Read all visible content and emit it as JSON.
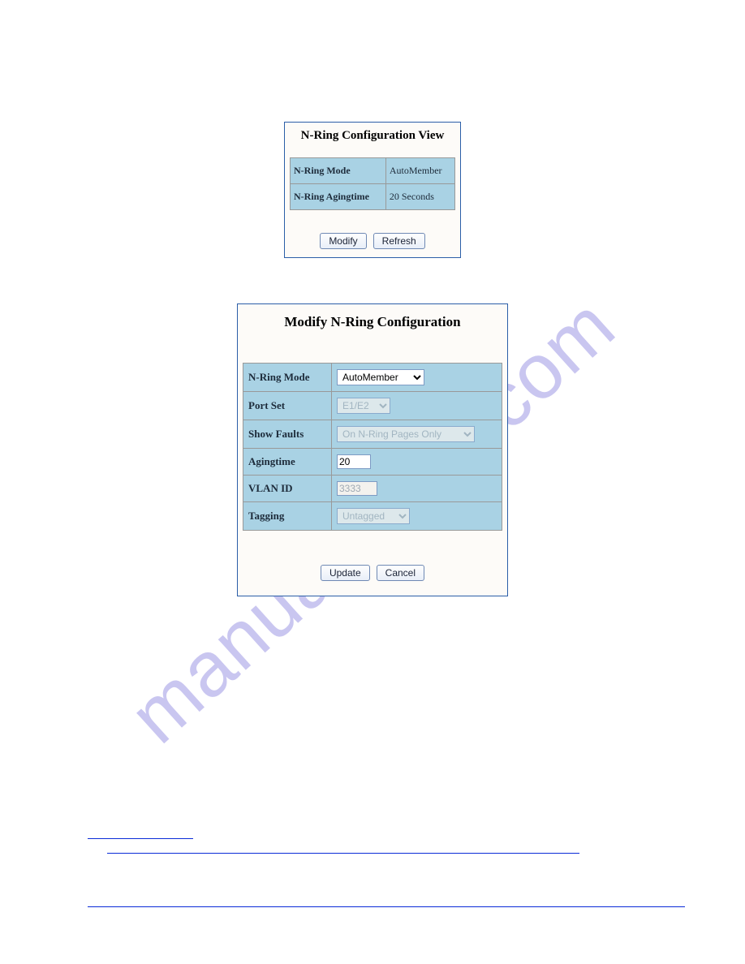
{
  "watermark": "manualshive.com",
  "viewPanel": {
    "title": "N-Ring Configuration View",
    "rows": {
      "modeLabel": "N-Ring Mode",
      "modeValue": "AutoMember",
      "agingLabel": "N-Ring Agingtime",
      "agingValue": "20 Seconds"
    },
    "buttons": {
      "modify": "Modify",
      "refresh": "Refresh"
    }
  },
  "modifyPanel": {
    "title": "Modify N-Ring Configuration",
    "labels": {
      "mode": "N-Ring Mode",
      "portSet": "Port Set",
      "showFaults": "Show Faults",
      "aging": "Agingtime",
      "vlan": "VLAN ID",
      "tagging": "Tagging"
    },
    "values": {
      "mode": "AutoMember",
      "portSet": "E1/E2",
      "showFaults": "On N-Ring Pages Only",
      "aging": "20",
      "vlan": "3333",
      "tagging": "Untagged"
    },
    "buttons": {
      "update": "Update",
      "cancel": "Cancel"
    }
  }
}
